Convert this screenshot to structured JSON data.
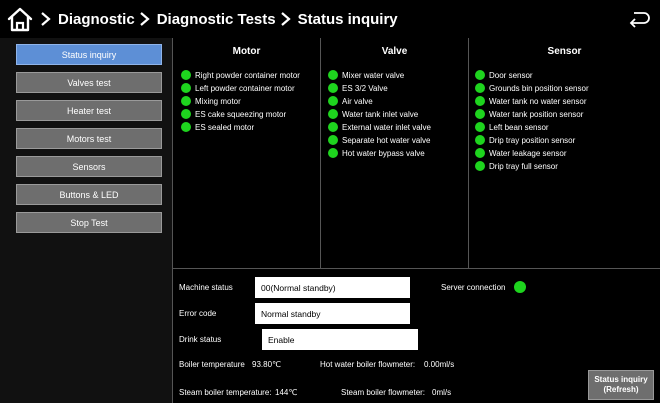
{
  "header": {
    "breadcrumbs": [
      "Diagnostic",
      "Diagnostic Tests",
      "Status inquiry"
    ]
  },
  "sidebar": {
    "items": [
      {
        "label": "Status inquiry",
        "active": true
      },
      {
        "label": "Valves test",
        "active": false
      },
      {
        "label": "Heater test",
        "active": false
      },
      {
        "label": "Motors test",
        "active": false
      },
      {
        "label": "Sensors",
        "active": false
      },
      {
        "label": "Buttons & LED",
        "active": false
      },
      {
        "label": "Stop Test",
        "active": false
      }
    ]
  },
  "motor": {
    "title": "Motor",
    "items": [
      "Right powder container motor",
      "Left powder container motor",
      "Mixing motor",
      "ES cake squeezing motor",
      "ES sealed motor"
    ]
  },
  "valve": {
    "title": "Valve",
    "items": [
      "Mixer water valve",
      "ES 3/2 Valve",
      "Air valve",
      "Water tank inlet valve",
      "External water inlet valve",
      "Separate hot water valve",
      "Hot water bypass valve"
    ]
  },
  "sensor": {
    "title": "Sensor",
    "items": [
      "Door sensor",
      "Grounds bin position sensor",
      "Water tank no water sensor",
      "Water tank position sensor",
      "Left bean sensor",
      "Drip tray position sensor",
      "Water leakage sensor",
      "Drip tray full sensor"
    ]
  },
  "status": {
    "machine_status_label": "Machine status",
    "machine_status_value": "00(Normal standby)",
    "server_connection_label": "Server connection",
    "error_code_label": "Error code",
    "error_code_value": "Normal standby",
    "drink_status_label": "Drink status",
    "drink_status_value": "Enable",
    "boiler_temp_label": "Boiler temperature",
    "boiler_temp_value": "93.80℃",
    "hot_flow_label": "Hot water boiler flowmeter:",
    "hot_flow_value": "0.00ml/s",
    "steam_temp_label": "Steam boiler temperature:",
    "steam_temp_value": "144℃",
    "steam_flow_label": "Steam boiler flowmeter:",
    "steam_flow_value": "0ml/s"
  },
  "refresh": {
    "line1": "Status inquiry",
    "line2": "(Refresh)"
  },
  "colors": {
    "ok_indicator": "#1ed41e",
    "active_button": "#5d8fd6",
    "button": "#6e6e6e"
  },
  "icons": {
    "home": "home-icon",
    "back": "back-arrow-icon",
    "separator": "chevron-right-icon"
  }
}
